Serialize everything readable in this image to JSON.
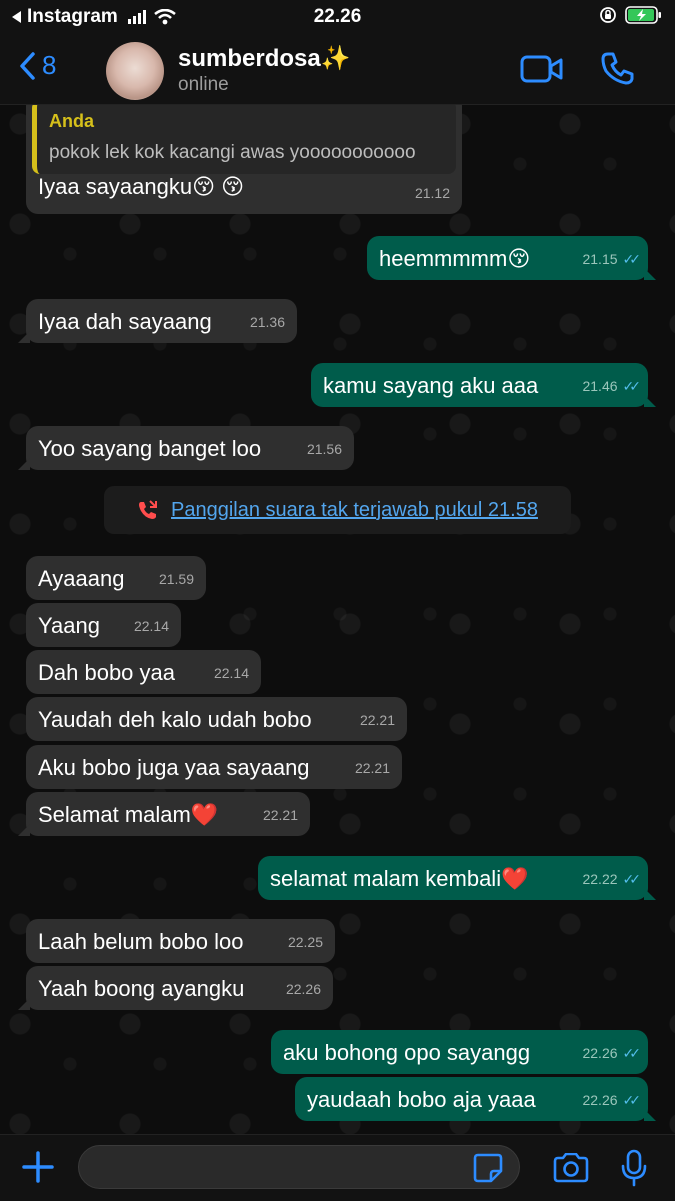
{
  "status_bar": {
    "back_app": "Instagram",
    "time": "22.26"
  },
  "header": {
    "back_count": "8",
    "name": "sumberdosa✨",
    "status": "online"
  },
  "quoted": {
    "name": "Anda",
    "text": "pokok lek kok kacangi awas yooooooooooo"
  },
  "messages": [
    {
      "dir": "in",
      "text": "Iyaa sayaangku😚 😚",
      "time": "21.12"
    },
    {
      "dir": "out",
      "text": "heemmmmm😚",
      "time": "21.15"
    },
    {
      "dir": "in",
      "text": "Iyaa dah sayaang",
      "time": "21.36"
    },
    {
      "dir": "out",
      "text": "kamu sayang aku aaa",
      "time": "21.46"
    },
    {
      "dir": "in",
      "text": "Yoo sayang banget loo",
      "time": "21.56"
    },
    {
      "dir": "in",
      "text": "Ayaaang",
      "time": "21.59"
    },
    {
      "dir": "in",
      "text": "Yaang",
      "time": "22.14"
    },
    {
      "dir": "in",
      "text": "Dah bobo yaa",
      "time": "22.14"
    },
    {
      "dir": "in",
      "text": "Yaudah deh kalo udah bobo",
      "time": "22.21"
    },
    {
      "dir": "in",
      "text": "Aku bobo juga yaa sayaang",
      "time": "22.21"
    },
    {
      "dir": "in",
      "text": "Selamat malam❤️",
      "time": "22.21"
    },
    {
      "dir": "out",
      "text": "selamat malam kembali❤️",
      "time": "22.22"
    },
    {
      "dir": "in",
      "text": "Laah belum bobo loo",
      "time": "22.25"
    },
    {
      "dir": "in",
      "text": "Yaah boong ayangku",
      "time": "22.26"
    },
    {
      "dir": "out",
      "text": "aku bohong opo sayangg",
      "time": "22.26"
    },
    {
      "dir": "out",
      "text": "yaudaah bobo aja yaaa",
      "time": "22.26"
    }
  ],
  "missed_call": {
    "text": "Panggilan suara tak terjawab pukul 21.58"
  },
  "input": {
    "placeholder": ""
  },
  "colors": {
    "incoming_bubble": "#2f2f2f",
    "outgoing_bubble": "#005c4b",
    "accent_blue": "#2d8cff",
    "read_ticks": "#53bdeb",
    "quote_bar": "#d6c01b"
  },
  "icons": [
    "back-chevron-icon",
    "video-call-icon",
    "phone-icon",
    "missed-call-icon",
    "plus-icon",
    "sticker-icon",
    "camera-icon",
    "mic-icon"
  ]
}
